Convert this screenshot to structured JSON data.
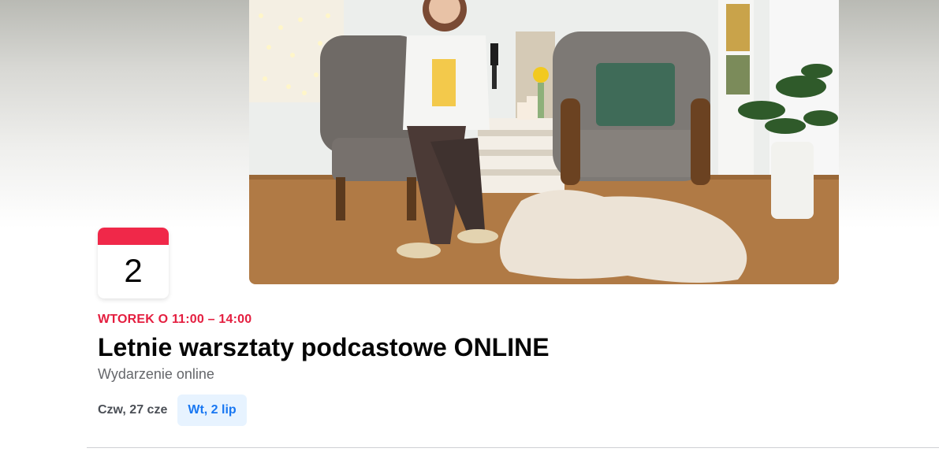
{
  "event": {
    "badge_day": "2",
    "time": "WTOREK O 11:00 – 14:00",
    "title": "Letnie warsztaty podcastowe ONLINE",
    "location": "Wydarzenie online"
  },
  "date_tabs": [
    {
      "label": "Czw, 27 cze",
      "active": false
    },
    {
      "label": "Wt, 2 lip",
      "active": true
    }
  ],
  "colors": {
    "accent_red": "#f02849",
    "time_red": "#e41e3f",
    "active_tab_bg": "#e7f3ff",
    "active_tab_text": "#1877f2"
  }
}
